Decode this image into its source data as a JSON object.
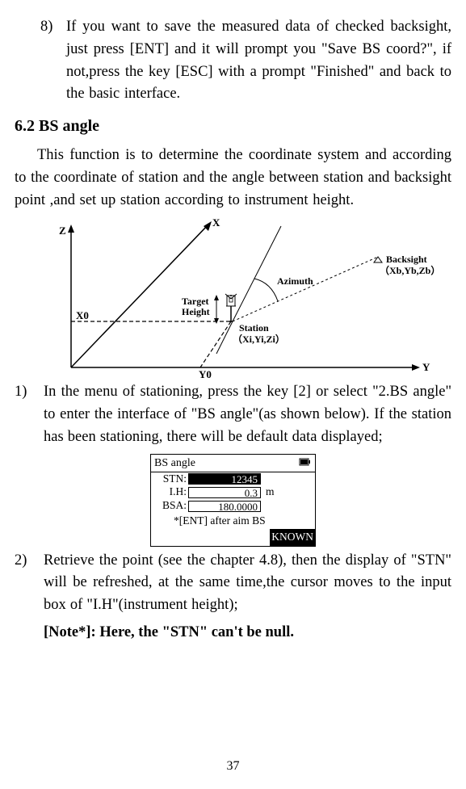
{
  "item8": {
    "num": "8)",
    "text": "If you want to save the measured data of checked backsight, just press [ENT] and it will prompt you \"Save BS coord?\", if not,press the key [ESC] with a prompt \"Finished\" and back to the basic interface."
  },
  "heading": "6.2 BS angle",
  "intro": "This function is to determine the coordinate system and according to the coordinate of station and the angle between station and backsight point ,and set up station according to instrument height.",
  "diagram": {
    "X": "X",
    "Y": "Y",
    "Z": "Z",
    "X0": "X0",
    "Y0": "Y0",
    "TargetHeight": "Target\nHeight",
    "Azimuth": "Azimuth",
    "Station": "Station",
    "StationCoord": "（Xi,Yi,Zi）",
    "Backsight": "Backsight",
    "BacksightCoord": "（Xb,Yb,Zb）"
  },
  "item1": {
    "num": "1)",
    "text": "In the menu of stationing, press the key [2] or select \"2.BS angle\" to enter the interface of \"BS angle\"(as shown below). If the station has been stationing, there will be default data displayed;"
  },
  "display": {
    "title": "BS angle",
    "stn_label": "STN:",
    "stn_value": "12345",
    "ih_label": "I.H:",
    "ih_value": "0.3",
    "ih_unit": "m",
    "bsa_label": "BSA:",
    "bsa_value": "180.0000",
    "hint": "*[ENT] after aim  BS",
    "known": "KNOWN"
  },
  "item2": {
    "num": "2)",
    "text": "Retrieve the point (see the chapter 4.8), then the display of \"STN\" will be refreshed, at the same time,the cursor moves to the input box of \"I.H\"(instrument height);"
  },
  "note": "[Note*]: Here, the \"STN\" can't be null.",
  "page_number": "37"
}
